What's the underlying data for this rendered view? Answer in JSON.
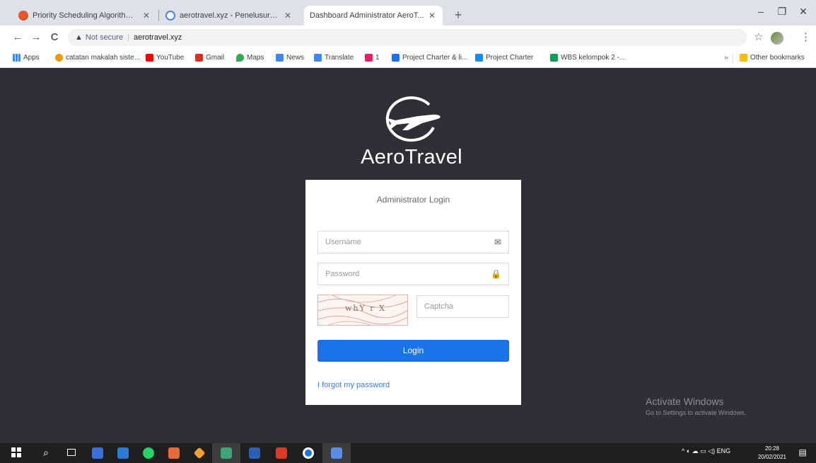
{
  "tabs": [
    {
      "title": "Priority Scheduling Algorithm ...",
      "favicon_color": "#e8542c"
    },
    {
      "title": "aerotravel.xyz - Penelusuran Go...",
      "favicon_color": "#4285f4"
    },
    {
      "title": "Dashboard Administrator AeroT...",
      "favicon_color": "#ffffff"
    }
  ],
  "new_tab": "+",
  "window_controls": {
    "minimize": "–",
    "maximize": "❐",
    "close": "✕"
  },
  "toolbar": {
    "back": "←",
    "forward": "→",
    "reload": "C",
    "warning_icon": "▲",
    "not_secure": "Not secure",
    "url": "aerotravel.xyz",
    "star": "☆",
    "menu": "⋮"
  },
  "bookmarks": [
    {
      "label": "Apps",
      "color": "#4285f4"
    },
    {
      "label": "catatan makalah siste...",
      "color": "#f29900"
    },
    {
      "label": "YouTube",
      "color": "#ff0000"
    },
    {
      "label": "Gmail",
      "color": "#d93025"
    },
    {
      "label": "Maps",
      "color": "#34a853"
    },
    {
      "label": "News",
      "color": "#4285f4"
    },
    {
      "label": "Translate",
      "color": "#4285f4"
    },
    {
      "label": "1",
      "color": "#e91e63"
    },
    {
      "label": "Project Charter & li...",
      "color": "#1a73e8"
    },
    {
      "label": "Project Charter",
      "color": "#1e88e5"
    },
    {
      "label": "WBS kelompok 2 -...",
      "color": "#0f9d58"
    }
  ],
  "other_bookmarks": {
    "chevron": "»",
    "label": "Other bookmarks",
    "color": "#fbbc04"
  },
  "brand": "AeroTravel",
  "login": {
    "title": "Administrator Login",
    "username_placeholder": "Username",
    "username_icon": "✉",
    "password_placeholder": "Password",
    "password_icon": "🔒",
    "captcha_text": "whY r X",
    "captcha_placeholder": "Captcha",
    "button": "Login",
    "forgot": "I forgot my password"
  },
  "activate_windows": {
    "title": "Activate Windows",
    "subtitle": "Go to Settings to activate Windows."
  },
  "taskbar": {
    "search_icon": "⌕",
    "tray_text": "^  ◐  ☁  ▭  ◁)  ENG",
    "time": "20:28",
    "date": "20/02/2021",
    "notification_icon": "▤"
  }
}
